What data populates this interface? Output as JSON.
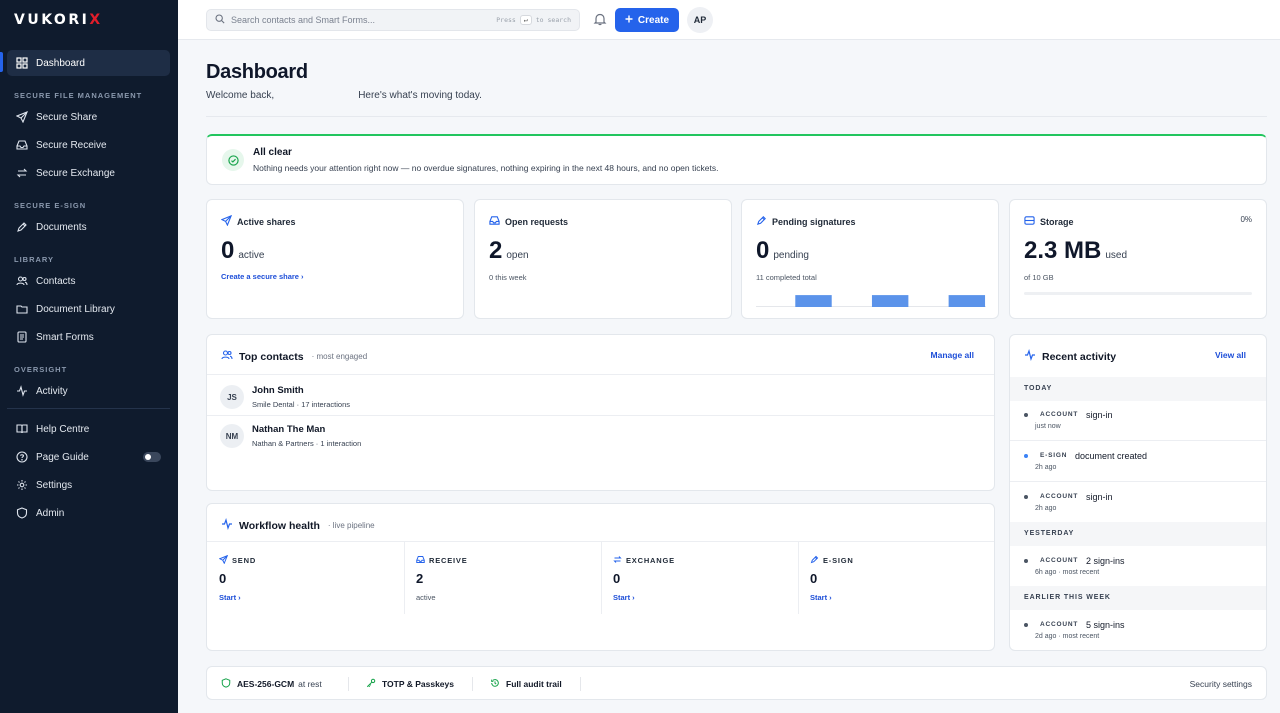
{
  "brand": {
    "name_main": "VUKORI",
    "name_accent": "X"
  },
  "sidebar": {
    "dashboard": "Dashboard",
    "sections": {
      "file_mgmt": "SECURE FILE MANAGEMENT",
      "esign": "SECURE E-SIGN",
      "library": "LIBRARY",
      "oversight": "OVERSIGHT"
    },
    "items": {
      "secure_share": "Secure Share",
      "secure_receive": "Secure Receive",
      "secure_exchange": "Secure Exchange",
      "documents": "Documents",
      "contacts": "Contacts",
      "document_library": "Document Library",
      "smart_forms": "Smart Forms",
      "activity": "Activity",
      "help_centre": "Help Centre",
      "page_guide": "Page Guide",
      "settings": "Settings",
      "admin": "Admin"
    },
    "page_guide_enabled": false
  },
  "topbar": {
    "search_placeholder": "Search contacts and Smart Forms...",
    "hint_press": "Press",
    "hint_key": "↵",
    "hint_to": "to search",
    "create": "Create",
    "avatar": "AP"
  },
  "header": {
    "title": "Dashboard",
    "welcome_prefix": "Welcome back,",
    "welcome_suffix": "Here's what's moving today."
  },
  "alert": {
    "title": "All clear",
    "message": "Nothing needs your attention right now — no overdue signatures, nothing expiring in the next 48 hours, and no open tickets."
  },
  "stats": {
    "active_shares": {
      "label": "Active shares",
      "value": "0",
      "unit": "active",
      "link": "Create a secure share"
    },
    "open_requests": {
      "label": "Open requests",
      "value": "2",
      "unit": "open",
      "sub": "0 this week"
    },
    "pending_signatures": {
      "label": "Pending signatures",
      "value": "0",
      "unit": "pending",
      "sub": "11 completed total",
      "spark": [
        0,
        1,
        0,
        1,
        0,
        1
      ]
    },
    "storage": {
      "label": "Storage",
      "value": "2.3 MB",
      "unit": "used",
      "sub": "of 10 GB",
      "percent": "0%",
      "fill": 0.0
    }
  },
  "top_contacts": {
    "title": "Top contacts",
    "aside": "· most engaged",
    "action": "Manage all",
    "rows": [
      {
        "initials": "JS",
        "name": "John Smith",
        "org": "Smile Dental",
        "interactions": "· 17 interactions"
      },
      {
        "initials": "NM",
        "name": "Nathan The Man",
        "org": "Nathan & Partners",
        "interactions": "· 1 interaction"
      }
    ]
  },
  "workflow": {
    "title": "Workflow health",
    "aside": "· live pipeline",
    "columns": [
      {
        "label": "SEND",
        "value": "0",
        "link": "Start"
      },
      {
        "label": "RECEIVE",
        "value": "2",
        "sub": "active"
      },
      {
        "label": "EXCHANGE",
        "value": "0",
        "link": "Start"
      },
      {
        "label": "E-SIGN",
        "value": "0",
        "link": "Start"
      }
    ]
  },
  "activity": {
    "title": "Recent activity",
    "action": "View all",
    "groups": {
      "today": "TODAY",
      "yesterday": "YESTERDAY",
      "earlier": "EARLIER THIS WEEK"
    },
    "items": [
      {
        "cat": "ACCOUNT",
        "text": "sign-in",
        "when": "just now"
      },
      {
        "cat": "E-SIGN",
        "text": "document created",
        "when": "2h ago"
      },
      {
        "cat": "ACCOUNT",
        "text": "sign-in",
        "when": "2h ago"
      },
      {
        "cat": "ACCOUNT",
        "text": "2 sign-ins",
        "when": "6h ago · most recent"
      },
      {
        "cat": "ACCOUNT",
        "text": "5 sign-ins",
        "when": "2d ago · most recent"
      }
    ]
  },
  "footer": {
    "enc": "AES-256-GCM",
    "enc_suffix": "at rest",
    "auth": "TOTP & Passkeys",
    "audit": "Full audit trail",
    "settings": "Security settings"
  },
  "colors": {
    "accent": "#2563eb",
    "success": "#22c55e",
    "sidebar": "#0f1b2d"
  }
}
